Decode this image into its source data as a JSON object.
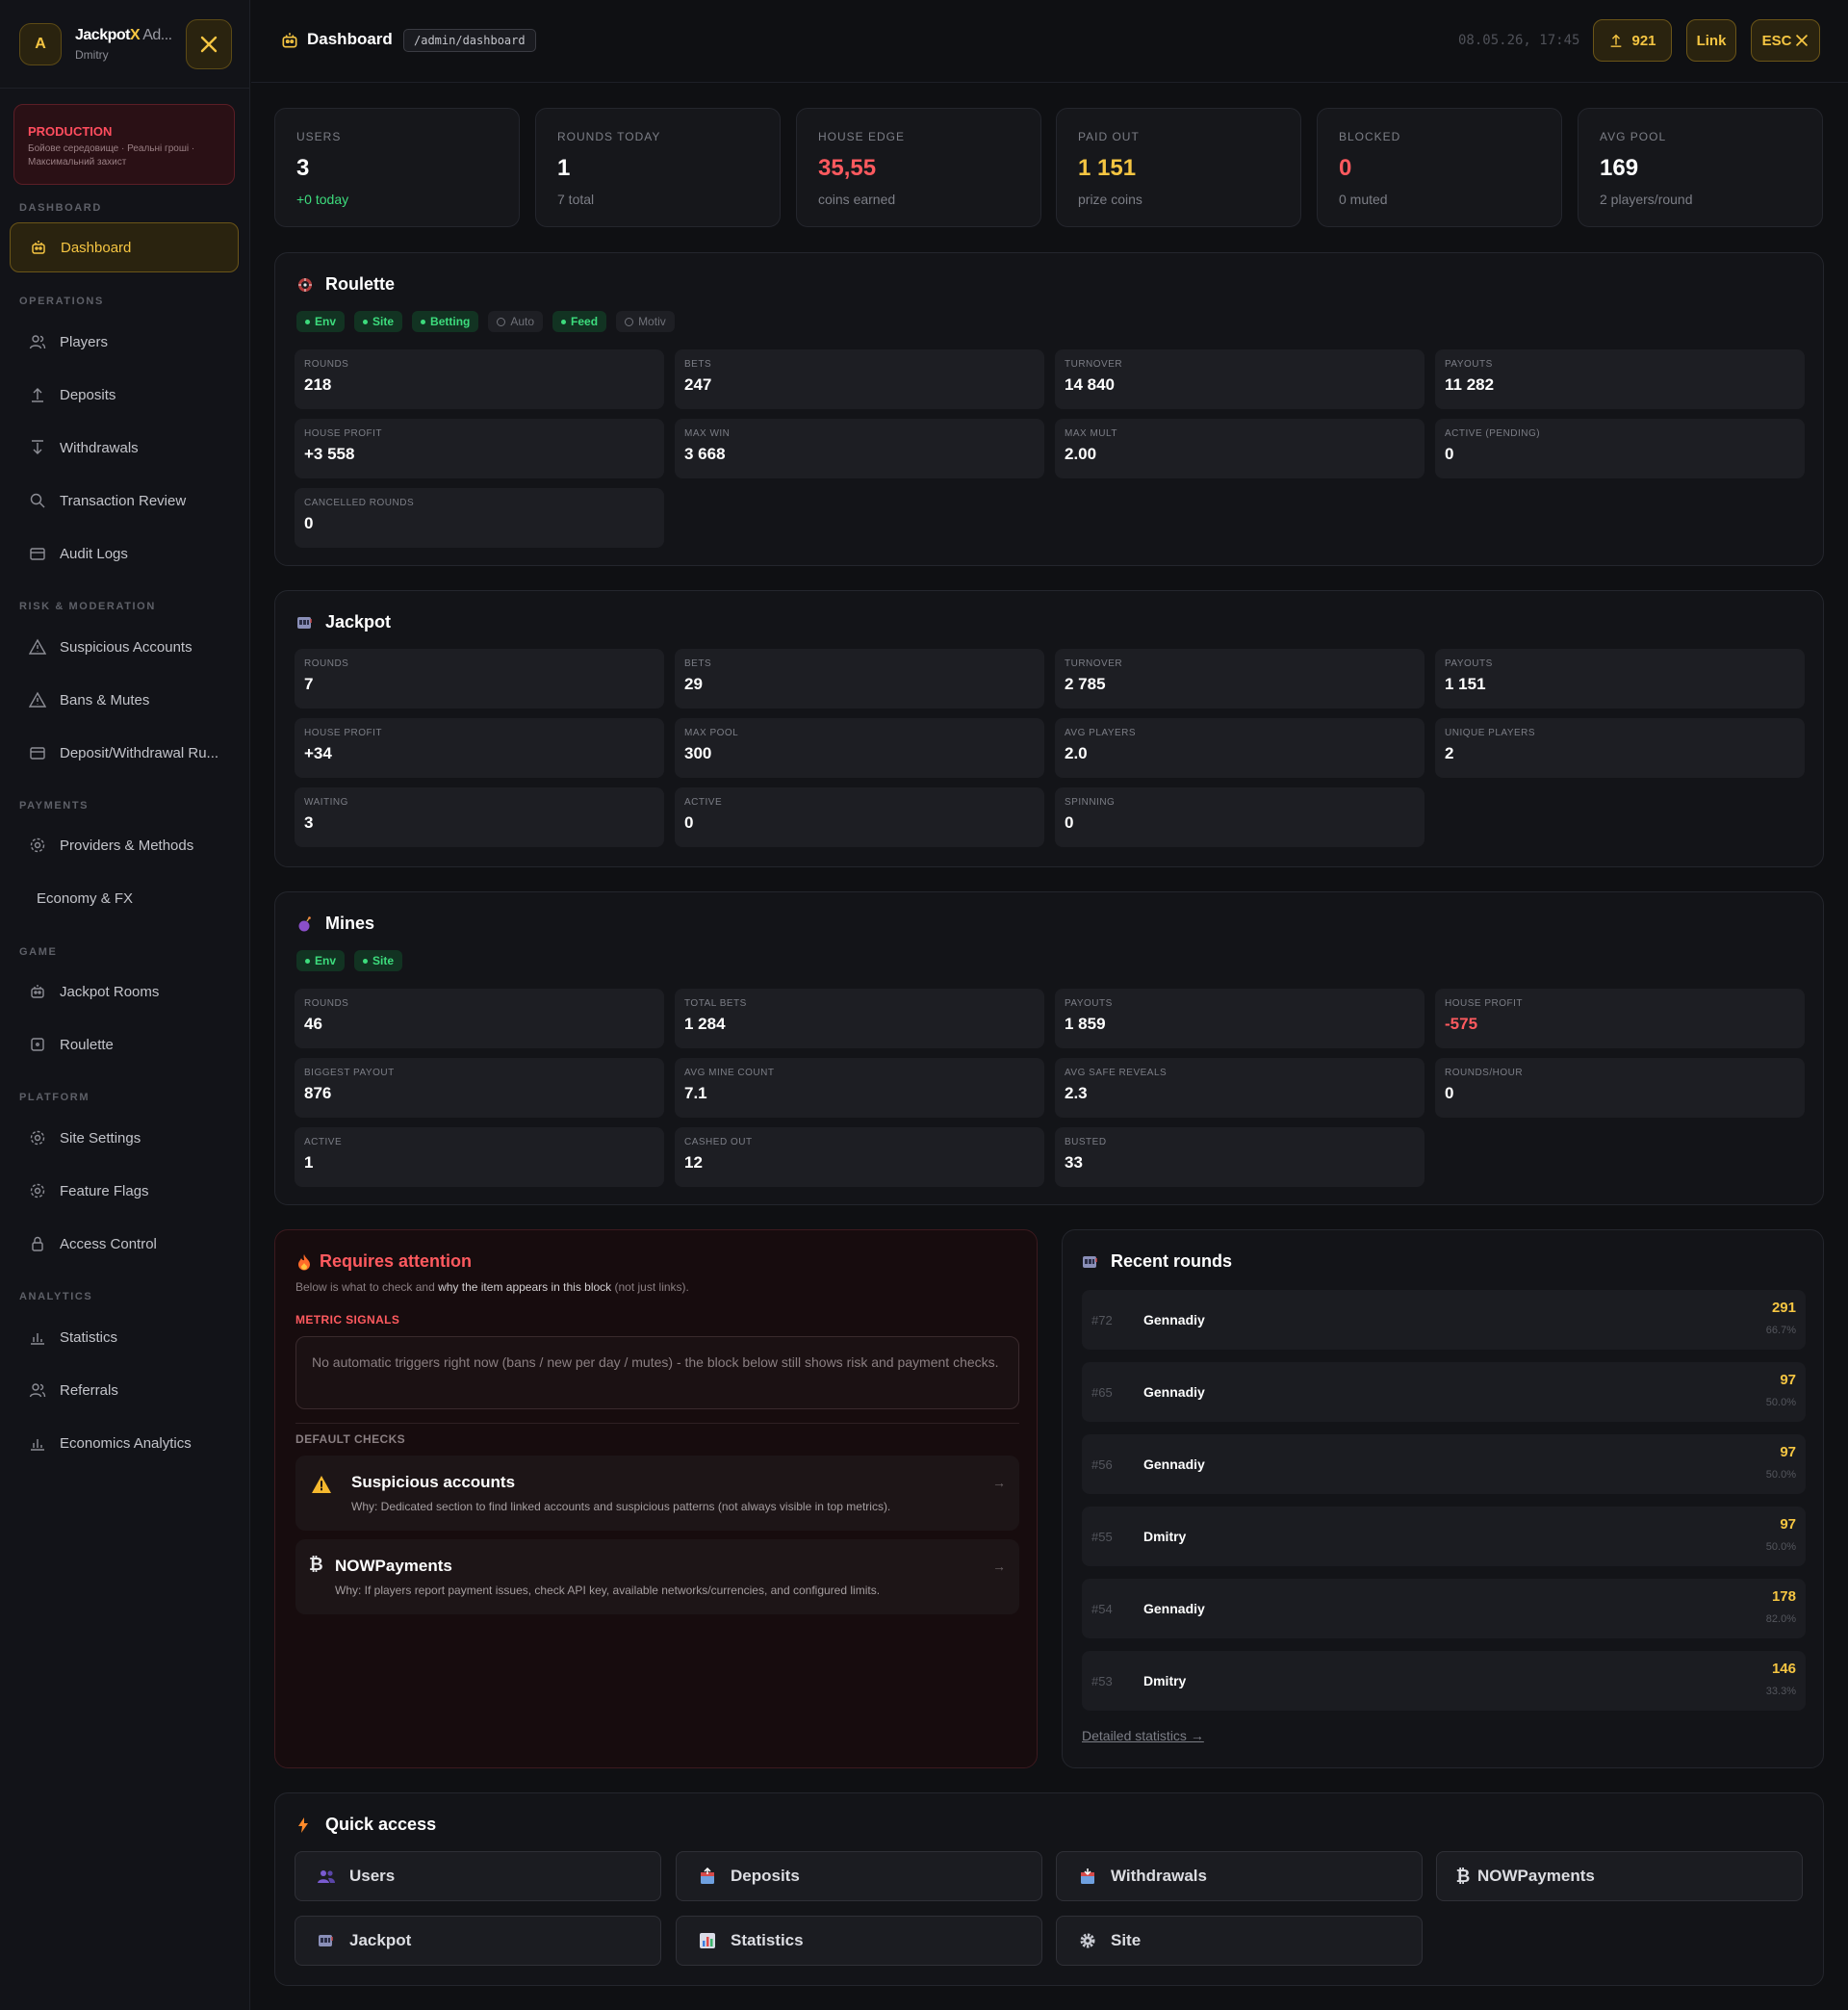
{
  "sidebar": {
    "avatar_letter": "A",
    "brand_main": "Jackpot",
    "brand_x": "X",
    "brand_suffix": " Ad...",
    "user": "Dmitry",
    "env": {
      "title": "PRODUCTION",
      "subtitle": "Бойове середовище · Реальні гроші · Максимальний захист"
    },
    "sections": {
      "dashboard": "DASHBOARD",
      "operations": "OPERATIONS",
      "risk": "RISK & MODERATION",
      "payments": "PAYMENTS",
      "game": "GAME",
      "platform": "PLATFORM",
      "analytics": "ANALYTICS"
    },
    "items": {
      "dashboard": "Dashboard",
      "players": "Players",
      "deposits": "Deposits",
      "withdrawals": "Withdrawals",
      "transaction_review": "Transaction Review",
      "audit_logs": "Audit Logs",
      "suspicious": "Suspicious Accounts",
      "bans": "Bans & Mutes",
      "dw_rules": "Deposit/Withdrawal Ru...",
      "providers": "Providers & Methods",
      "economy": "Economy & FX",
      "jackpot_rooms": "Jackpot Rooms",
      "roulette": "Roulette",
      "site_settings": "Site Settings",
      "feature_flags": "Feature Flags",
      "access_control": "Access Control",
      "statistics": "Statistics",
      "referrals": "Referrals",
      "economics_analytics": "Economics Analytics"
    }
  },
  "header": {
    "title": "Dashboard",
    "path": "/admin/dashboard",
    "datetime": "08.05.26, 17:45",
    "counter": "921",
    "link_label": "Link",
    "esc_label": "ESC"
  },
  "stats": [
    {
      "label": "USERS",
      "value": "3",
      "sub": "+0 today",
      "value_color": "#ffffff",
      "sub_color": "#3ddc7d"
    },
    {
      "label": "ROUNDS TODAY",
      "value": "1",
      "sub": "7 total",
      "value_color": "#ffffff",
      "sub_color": "#7c7e86"
    },
    {
      "label": "HOUSE EDGE",
      "value": "35,55",
      "sub": "coins earned",
      "value_color": "#ff5a5f",
      "sub_color": "#7c7e86"
    },
    {
      "label": "PAID OUT",
      "value": "1 151",
      "sub": "prize coins",
      "value_color": "#f5c542",
      "sub_color": "#7c7e86"
    },
    {
      "label": "BLOCKED",
      "value": "0",
      "sub": "0 muted",
      "value_color": "#ff5a5f",
      "sub_color": "#7c7e86"
    },
    {
      "label": "AVG POOL",
      "value": "169",
      "sub": "2 players/round",
      "value_color": "#ffffff",
      "sub_color": "#7c7e86"
    }
  ],
  "roulette": {
    "title": "Roulette",
    "tags": [
      {
        "label": "Env",
        "on": true
      },
      {
        "label": "Site",
        "on": true
      },
      {
        "label": "Betting",
        "on": true
      },
      {
        "label": "Auto",
        "on": false
      },
      {
        "label": "Feed",
        "on": true
      },
      {
        "label": "Motiv",
        "on": false
      }
    ],
    "cells": [
      {
        "label": "ROUNDS",
        "value": "218"
      },
      {
        "label": "BETS",
        "value": "247"
      },
      {
        "label": "TURNOVER",
        "value": "14 840"
      },
      {
        "label": "PAYOUTS",
        "value": "11 282"
      },
      {
        "label": "HOUSE PROFIT",
        "value": "+3 558"
      },
      {
        "label": "MAX WIN",
        "value": "3 668"
      },
      {
        "label": "MAX MULT",
        "value": "2.00"
      },
      {
        "label": "ACTIVE (PENDING)",
        "value": "0"
      },
      {
        "label": "CANCELLED ROUNDS",
        "value": "0"
      }
    ]
  },
  "jackpot": {
    "title": "Jackpot",
    "cells": [
      {
        "label": "ROUNDS",
        "value": "7"
      },
      {
        "label": "BETS",
        "value": "29"
      },
      {
        "label": "TURNOVER",
        "value": "2 785"
      },
      {
        "label": "PAYOUTS",
        "value": "1 151"
      },
      {
        "label": "HOUSE PROFIT",
        "value": "+34"
      },
      {
        "label": "MAX POOL",
        "value": "300"
      },
      {
        "label": "AVG PLAYERS",
        "value": "2.0"
      },
      {
        "label": "UNIQUE PLAYERS",
        "value": "2"
      },
      {
        "label": "WAITING",
        "value": "3"
      },
      {
        "label": "ACTIVE",
        "value": "0"
      },
      {
        "label": "SPINNING",
        "value": "0"
      }
    ]
  },
  "mines": {
    "title": "Mines",
    "tags": [
      {
        "label": "Env",
        "on": true
      },
      {
        "label": "Site",
        "on": true
      }
    ],
    "cells": [
      {
        "label": "ROUNDS",
        "value": "46"
      },
      {
        "label": "TOTAL BETS",
        "value": "1 284"
      },
      {
        "label": "PAYOUTS",
        "value": "1 859"
      },
      {
        "label": "HOUSE PROFIT",
        "value": "-575",
        "negative": true
      },
      {
        "label": "BIGGEST PAYOUT",
        "value": "876"
      },
      {
        "label": "AVG MINE COUNT",
        "value": "7.1"
      },
      {
        "label": "AVG SAFE REVEALS",
        "value": "2.3"
      },
      {
        "label": "ROUNDS/HOUR",
        "value": "0"
      },
      {
        "label": "ACTIVE",
        "value": "1"
      },
      {
        "label": "CASHED OUT",
        "value": "12"
      },
      {
        "label": "BUSTED",
        "value": "33"
      }
    ]
  },
  "attention": {
    "title": "Requires attention",
    "sub_pre": "Below is what to check and ",
    "sub_bold": "why the item appears in this block",
    "sub_post": " (not just links).",
    "signals_label": "METRIC SIGNALS",
    "signals_text": "No automatic triggers right now (bans / new per day / mutes) - the block below still shows risk and payment checks.",
    "default_label": "DEFAULT CHECKS",
    "checks": [
      {
        "title": "Suspicious accounts",
        "why": "Why: Dedicated section to find linked accounts and suspicious patterns (not always visible in top metrics)."
      },
      {
        "title": "NOWPayments",
        "why": "Why: If players report payment issues, check API key, available networks/currencies, and configured limits."
      }
    ]
  },
  "recent": {
    "title": "Recent rounds",
    "rows": [
      {
        "id": "#72",
        "name": "Gennadiy",
        "amount": "291",
        "pct": "66.7%"
      },
      {
        "id": "#65",
        "name": "Gennadiy",
        "amount": "97",
        "pct": "50.0%"
      },
      {
        "id": "#56",
        "name": "Gennadiy",
        "amount": "97",
        "pct": "50.0%"
      },
      {
        "id": "#55",
        "name": "Dmitry",
        "amount": "97",
        "pct": "50.0%"
      },
      {
        "id": "#54",
        "name": "Gennadiy",
        "amount": "178",
        "pct": "82.0%"
      },
      {
        "id": "#53",
        "name": "Dmitry",
        "amount": "146",
        "pct": "33.3%"
      }
    ],
    "link": "Detailed statistics →"
  },
  "quick": {
    "title": "Quick access",
    "items": [
      {
        "label": "Users",
        "icon": "users-icon"
      },
      {
        "label": "Deposits",
        "icon": "deposit-icon"
      },
      {
        "label": "Withdrawals",
        "icon": "withdrawal-icon"
      },
      {
        "label": "NOWPayments",
        "icon": "bitcoin-icon"
      },
      {
        "label": "Jackpot",
        "icon": "slot-icon"
      },
      {
        "label": "Statistics",
        "icon": "chart-icon"
      },
      {
        "label": "Site",
        "icon": "gear-icon"
      }
    ]
  },
  "colors": {
    "accent": "#f5c542",
    "danger": "#ff5a5f",
    "success": "#3ddc7d"
  }
}
